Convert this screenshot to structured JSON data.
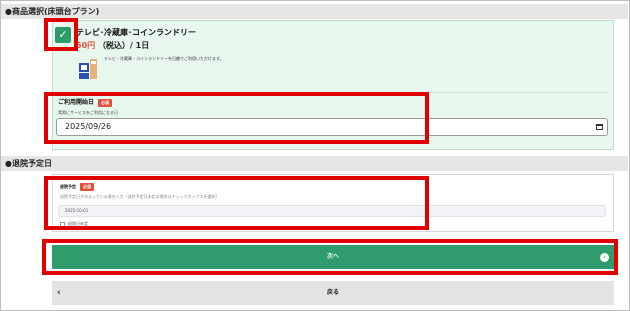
{
  "sections": {
    "product": "●商品選択(床頭台プラン)",
    "discharge": "●退院予定日"
  },
  "product": {
    "checkbox_mark": "✓",
    "name": "テレビ･冷蔵庫･コインランドリー",
    "price_amount": "50円",
    "price_unit": "（税込）/ 1日",
    "description": "テレビ・冷蔵庫・コインランドリーを日額でご利用いただけます。"
  },
  "start_date": {
    "label": "ご利用開始日",
    "required": "必須",
    "hint": "実際にサービスをご利用になる日",
    "value": "2025/09/26"
  },
  "discharge_date": {
    "label": "退院予定",
    "required": "必須",
    "hint": "退院予定日が決まっている場合入力（退院予定日未定の場合はチェックボックスを選択）",
    "value": "2025-10-01",
    "checkbox_label": "退院日未定"
  },
  "buttons": {
    "next": "次へ",
    "next_arrow": "›",
    "back": "戻る",
    "back_arrow": "‹"
  },
  "colors": {
    "accent_green": "#2e9d6b",
    "highlight_red": "#e00000",
    "price_red": "#e0533a"
  }
}
